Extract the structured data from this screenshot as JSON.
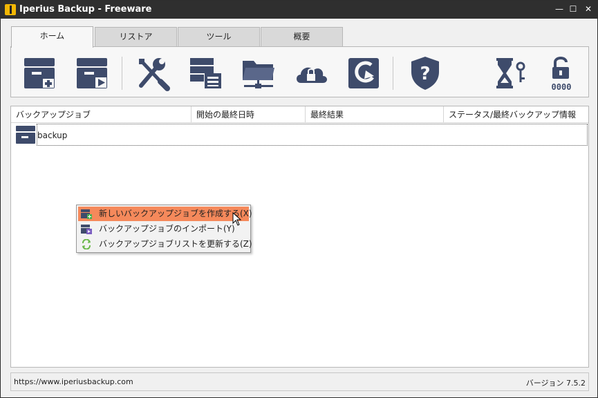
{
  "window": {
    "title": "Iperius Backup - Freeware",
    "controls": {
      "minimize": "—",
      "maximize": "☐",
      "close": "✕"
    }
  },
  "tabs": [
    {
      "label": "ホーム",
      "active": true
    },
    {
      "label": "リストア",
      "active": false
    },
    {
      "label": "ツール",
      "active": false
    },
    {
      "label": "概要",
      "active": false
    }
  ],
  "toolbar": {
    "icons": [
      "new-backup-job-icon",
      "run-backup-icon",
      "options-tools-icon",
      "log-list-icon",
      "network-folder-icon",
      "cloud-lock-icon",
      "update-icon",
      "help-shield-icon",
      "scheduler-key-icon",
      "unlock-code-icon"
    ],
    "code_text": "0000"
  },
  "table": {
    "columns": [
      "バックアップジョブ",
      "開始の最終日時",
      "最終結果",
      "ステータス/最終バックアップ情報"
    ],
    "rows": [
      {
        "name": "backup"
      }
    ]
  },
  "context_menu": {
    "items": [
      {
        "label": "新しいバックアップジョブを作成する(X)",
        "icon": "new-job-icon",
        "highlighted": true
      },
      {
        "label": "バックアップジョブのインポート(Y)",
        "icon": "import-icon",
        "highlighted": false
      },
      {
        "label": "バックアップジョブリストを更新する(Z)",
        "icon": "refresh-icon",
        "highlighted": false
      }
    ]
  },
  "status": {
    "url": "https://www.iperiusbackup.com",
    "version": "バージョン 7.5.2"
  },
  "colors": {
    "icon_navy": "#3e4b6b",
    "highlight": "#f5895b",
    "titlebar": "#2f2f2f",
    "accent_yellow": "#f2b705"
  }
}
